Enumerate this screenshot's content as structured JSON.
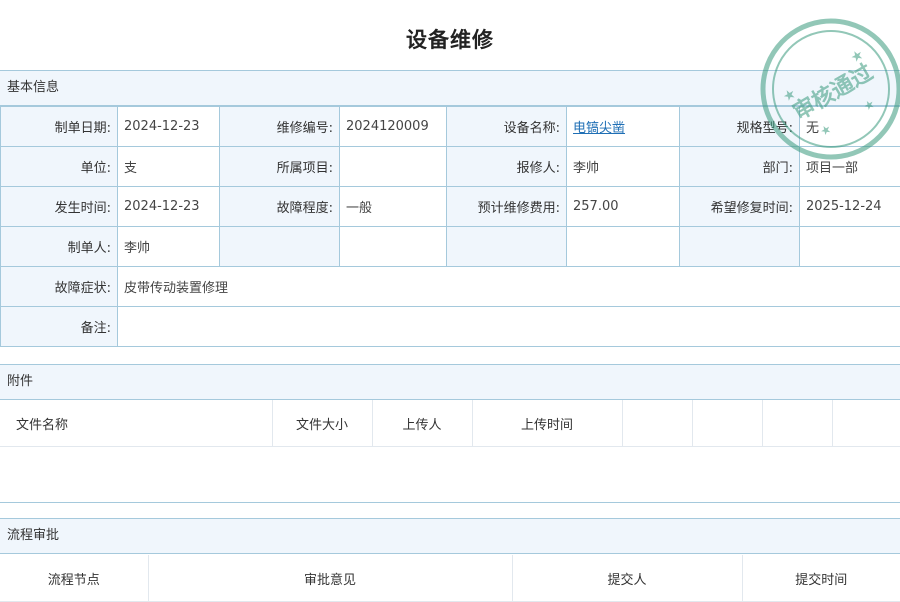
{
  "title": "设备维修",
  "basic": {
    "header": "基本信息",
    "rows": [
      [
        {
          "label": "制单日期:",
          "value": "2024-12-23"
        },
        {
          "label": "维修编号:",
          "value": "2024120009"
        },
        {
          "label": "设备名称:",
          "value": "电镐尖凿"
        },
        {
          "label": "规格型号:",
          "value": "无"
        }
      ],
      [
        {
          "label": "单位:",
          "value": "支"
        },
        {
          "label": "所属项目:",
          "value": ""
        },
        {
          "label": "报修人:",
          "value": "李帅"
        },
        {
          "label": "部门:",
          "value": "项目一部"
        }
      ],
      [
        {
          "label": "发生时间:",
          "value": "2024-12-23"
        },
        {
          "label": "故障程度:",
          "value": "一般"
        },
        {
          "label": "预计维修费用:",
          "value": "257.00"
        },
        {
          "label": "希望修复时间:",
          "value": "2025-12-24"
        }
      ],
      [
        {
          "label": "制单人:",
          "value": "李帅"
        }
      ]
    ],
    "symptom_label": "故障症状:",
    "symptom_value": "皮带传动装置修理",
    "remark_label": "备注:",
    "remark_value": ""
  },
  "attachments": {
    "header": "附件",
    "columns": [
      "文件名称",
      "文件大小",
      "上传人",
      "上传时间",
      "",
      "",
      "",
      ""
    ]
  },
  "workflow": {
    "header": "流程审批",
    "columns": [
      "流程节点",
      "审批意见",
      "提交人",
      "提交时间"
    ]
  },
  "stamp": {
    "text": "审核通过",
    "color": "#3a9a7e",
    "icon": "approval-stamp-icon"
  },
  "colors": {
    "border": "#a5c9dc",
    "label_bg": "#f0f6fc",
    "link": "#1f6fb5"
  }
}
